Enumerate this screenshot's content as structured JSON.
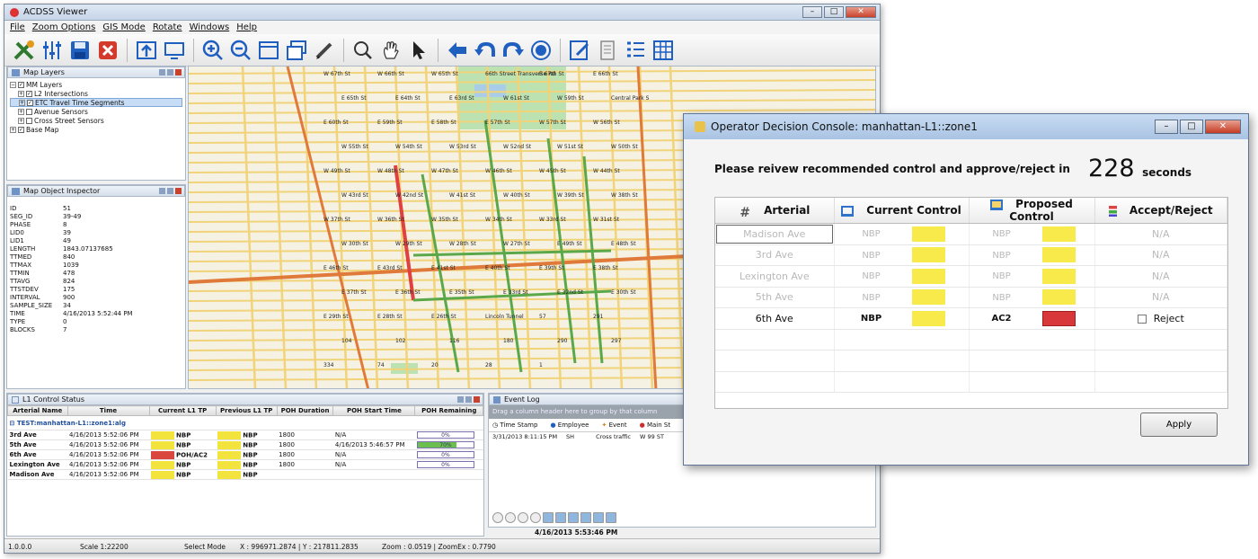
{
  "main_window": {
    "title": "ACDSS Viewer",
    "menu": [
      "File",
      "Zoom Options",
      "GIS Mode",
      "Rotate",
      "Windows",
      "Help"
    ]
  },
  "colors": {
    "yellow": "#f2e43c",
    "red": "#d9473e",
    "green": "#6bbf4e",
    "accent": "#1f5fbf"
  },
  "toolbar_icons": [
    "tools-icon",
    "sliders-icon",
    "save-icon",
    "close-red-icon",
    "upload-icon",
    "monitor-icon",
    "zoom-in-icon",
    "zoom-out-icon",
    "window-icon",
    "windows-icon",
    "pencil-icon",
    "search-icon",
    "hand-icon",
    "pointer-icon",
    "arrow-left-icon",
    "undo-icon",
    "redo-icon",
    "record-icon",
    "edit-icon",
    "document-icon",
    "list-icon",
    "table-icon"
  ],
  "map_layers": {
    "title": "Map Layers",
    "items": [
      {
        "label": "MM Layers",
        "checked": true
      },
      {
        "label": "L2 Intersections",
        "checked": true
      },
      {
        "label": "ETC Travel Time Segments",
        "checked": true
      },
      {
        "label": "Avenue Sensors",
        "checked": false
      },
      {
        "label": "Cross Street Sensors",
        "checked": false
      },
      {
        "label": "Base Map",
        "checked": true
      }
    ]
  },
  "inspector": {
    "title": "Map Object Inspector",
    "rows": [
      {
        "k": "ID",
        "v": "51"
      },
      {
        "k": "SEG_ID",
        "v": "39-49"
      },
      {
        "k": "PHASE",
        "v": "8"
      },
      {
        "k": "LID0",
        "v": "39"
      },
      {
        "k": "LID1",
        "v": "49"
      },
      {
        "k": "LENGTH",
        "v": "1843.07137685"
      },
      {
        "k": "TTMED",
        "v": "840"
      },
      {
        "k": "TTMAX",
        "v": "1039"
      },
      {
        "k": "TTMIN",
        "v": "478"
      },
      {
        "k": "TTAVG",
        "v": "824"
      },
      {
        "k": "TTSTDEV",
        "v": "175"
      },
      {
        "k": "INTERVAL",
        "v": "900"
      },
      {
        "k": "SAMPLE_SIZE",
        "v": "34"
      },
      {
        "k": "TIME",
        "v": "4/16/2013 5:52:44 PM"
      },
      {
        "k": "TYPE",
        "v": "0"
      },
      {
        "k": "BLOCKS",
        "v": "7"
      }
    ]
  },
  "map_labels": [
    "W 67th St",
    "W 66th St",
    "W 65th St",
    "66th Street Transverse Rd",
    "E 67th St",
    "E 66th St",
    "E 65th St",
    "E 64th St",
    "E 63rd St",
    "W 61st St",
    "W 59th St",
    "Central Park S",
    "E 60th St",
    "E 59th St",
    "E 58th St",
    "E 57th St",
    "W 57th St",
    "W 56th St",
    "W 55th St",
    "W 54th St",
    "W 53rd St",
    "W 52nd St",
    "W 51st St",
    "W 50th St",
    "W 49th St",
    "W 48th St",
    "W 47th St",
    "W 46th St",
    "W 45th St",
    "W 44th St",
    "W 43rd St",
    "W 42nd St",
    "W 41st St",
    "W 40th St",
    "W 39th St",
    "W 38th St",
    "W 37th St",
    "W 36th St",
    "W 35th St",
    "W 34th St",
    "W 33rd St",
    "W 31st St",
    "W 30th St",
    "W 29th St",
    "W 28th St",
    "W 27th St",
    "E 49th St",
    "E 48th St",
    "E 46th St",
    "E 43rd St",
    "E 41st St",
    "E 40th St",
    "E 39th St",
    "E 38th St",
    "E 37th St",
    "E 36th St",
    "E 35th St",
    "E 33rd St",
    "E 32nd St",
    "E 30th St",
    "E 29th St",
    "E 28th St",
    "E 26th St",
    "Lincoln Tunnel",
    "57",
    "291",
    "104",
    "102",
    "116",
    "180",
    "290",
    "297",
    "334",
    "74",
    "20",
    "28",
    "1"
  ],
  "l1": {
    "title": "L1 Control Status",
    "columns": [
      "Arterial Name",
      "Time",
      "Current L1 TP",
      "Previous L1 TP",
      "POH Duration",
      "POH Start Time",
      "POH Remaining"
    ],
    "group": "TEST:manhattan-L1::zone1:alg",
    "rows": [
      {
        "name": "3rd Ave",
        "time": "4/16/2013 5:52:06 PM",
        "cur": "NBP",
        "cur_color": "#f2e43c",
        "prev": "NBP",
        "prev_color": "#f2e43c",
        "dur": "1800",
        "start": "N/A",
        "remaining": "0%",
        "pct": 0
      },
      {
        "name": "5th Ave",
        "time": "4/16/2013 5:52:06 PM",
        "cur": "NBP",
        "cur_color": "#f2e43c",
        "prev": "NBP",
        "prev_color": "#f2e43c",
        "dur": "1800",
        "start": "4/16/2013 5:46:57 PM",
        "remaining": "70%",
        "pct": 0.7
      },
      {
        "name": "6th Ave",
        "time": "4/16/2013 5:52:06 PM",
        "cur": "POH/AC2",
        "cur_color": "#d9473e",
        "prev": "NBP",
        "prev_color": "#f2e43c",
        "dur": "1800",
        "start": "N/A",
        "remaining": "0%",
        "pct": 0
      },
      {
        "name": "Lexington Ave",
        "time": "4/16/2013 5:52:06 PM",
        "cur": "NBP",
        "cur_color": "#f2e43c",
        "prev": "NBP",
        "prev_color": "#f2e43c",
        "dur": "1800",
        "start": "N/A",
        "remaining": "0%",
        "pct": 0
      },
      {
        "name": "Madison Ave",
        "time": "4/16/2013 5:52:06 PM",
        "cur": "NBP",
        "cur_color": "#f2e43c",
        "prev": "NBP",
        "prev_color": "#f2e43c",
        "dur": "",
        "start": "",
        "remaining": "",
        "pct": 0
      }
    ]
  },
  "event_log": {
    "title": "Event Log",
    "group_hint": "Drag a column header here to group by that column",
    "columns": [
      "Time Stamp",
      "Employee",
      "Event",
      "Main St"
    ],
    "row": {
      "time": "3/31/2013 8:11:15 PM",
      "emp": "SH",
      "event": "Cross traffic",
      "street": "W 99 ST"
    },
    "timestamp": "4/16/2013 5:53:46 PM"
  },
  "status": {
    "version": "1.0.0.0",
    "scale": "Scale 1:22200",
    "mode": "Select Mode",
    "coords": "X : 996971.2874 | Y : 217811.2835",
    "zoom": "Zoom : 0.0519 | ZoomEx : 0.7790"
  },
  "console": {
    "title": "Operator Decision Console: manhattan-L1::zone1",
    "prompt": "Please reivew recommended control and approve/reject in",
    "countdown": "228",
    "countdown_unit": "seconds",
    "columns": [
      "Arterial",
      "Current Control",
      "Proposed Control",
      "Accept/Reject"
    ],
    "rows": [
      {
        "arterial": "Madison Ave",
        "current": "NBP",
        "current_color": "#f7ea4a",
        "proposed": "NBP",
        "proposed_color": "#f7ea4a",
        "decision": "N/A"
      },
      {
        "arterial": "3rd Ave",
        "current": "NBP",
        "current_color": "#f7ea4a",
        "proposed": "NBP",
        "proposed_color": "#f7ea4a",
        "decision": "N/A"
      },
      {
        "arterial": "Lexington Ave",
        "current": "NBP",
        "current_color": "#f7ea4a",
        "proposed": "NBP",
        "proposed_color": "#f7ea4a",
        "decision": "N/A"
      },
      {
        "arterial": "5th Ave",
        "current": "NBP",
        "current_color": "#f7ea4a",
        "proposed": "NBP",
        "proposed_color": "#f7ea4a",
        "decision": "N/A"
      },
      {
        "arterial": "6th Ave",
        "current": "NBP",
        "current_color": "#f7ea4a",
        "proposed": "AC2",
        "proposed_color": "#d9383a",
        "decision": "Reject"
      }
    ],
    "apply_label": "Apply"
  }
}
